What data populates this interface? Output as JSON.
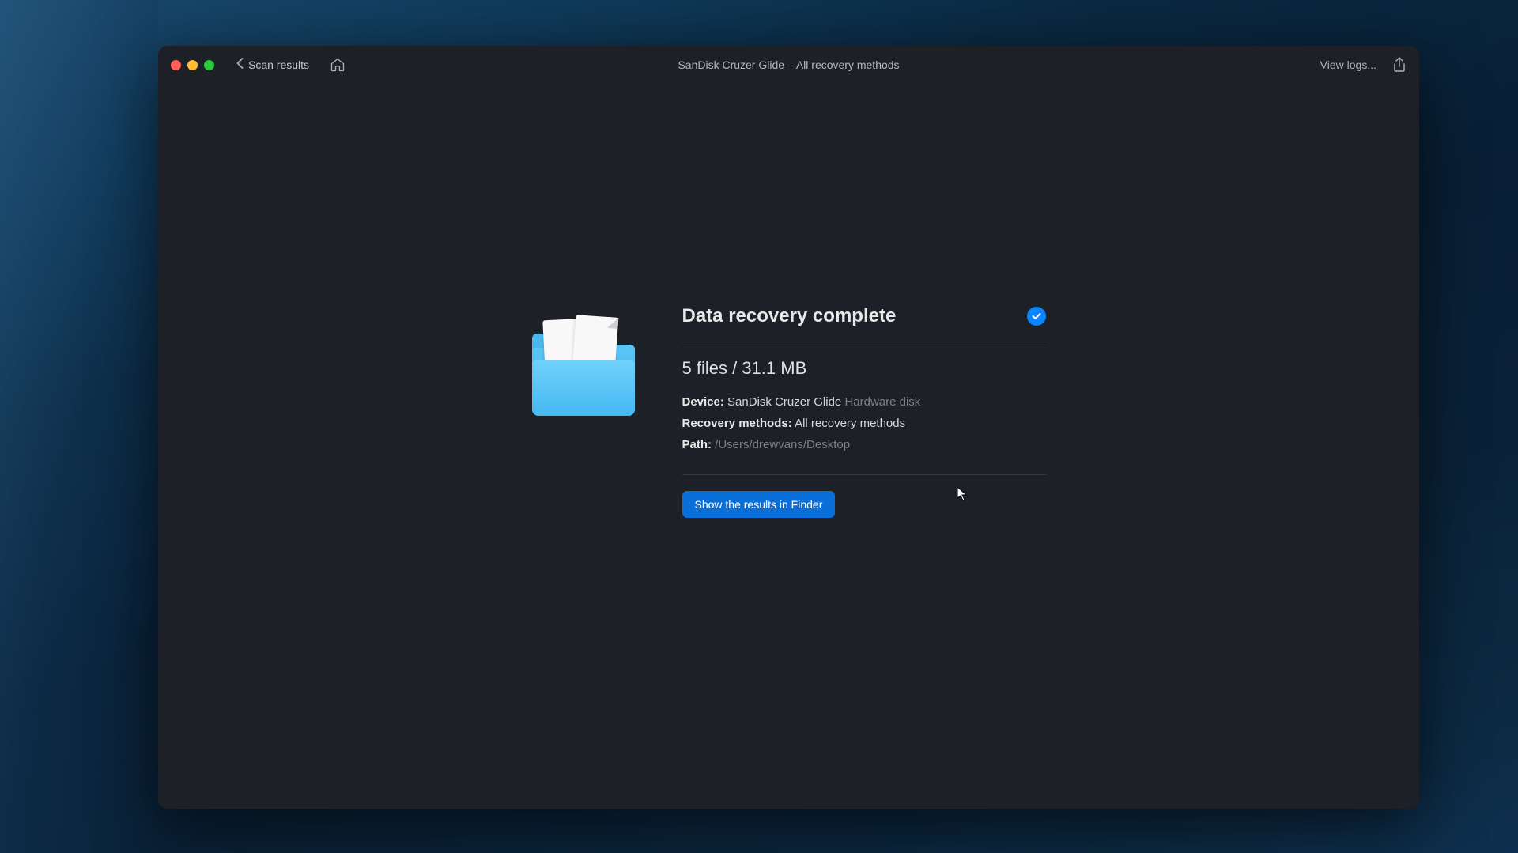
{
  "titlebar": {
    "back_label": "Scan results",
    "window_title": "SanDisk Cruzer Glide – All recovery methods",
    "view_logs_label": "View logs..."
  },
  "recovery": {
    "title": "Data recovery complete",
    "summary": "5 files / 31.1 MB",
    "device_label": "Device:",
    "device_value": "SanDisk Cruzer Glide",
    "device_meta": "Hardware disk",
    "methods_label": "Recovery methods:",
    "methods_value": "All recovery methods",
    "path_label": "Path:",
    "path_value": "/Users/drewvans/Desktop",
    "finder_button_label": "Show the results in Finder"
  }
}
